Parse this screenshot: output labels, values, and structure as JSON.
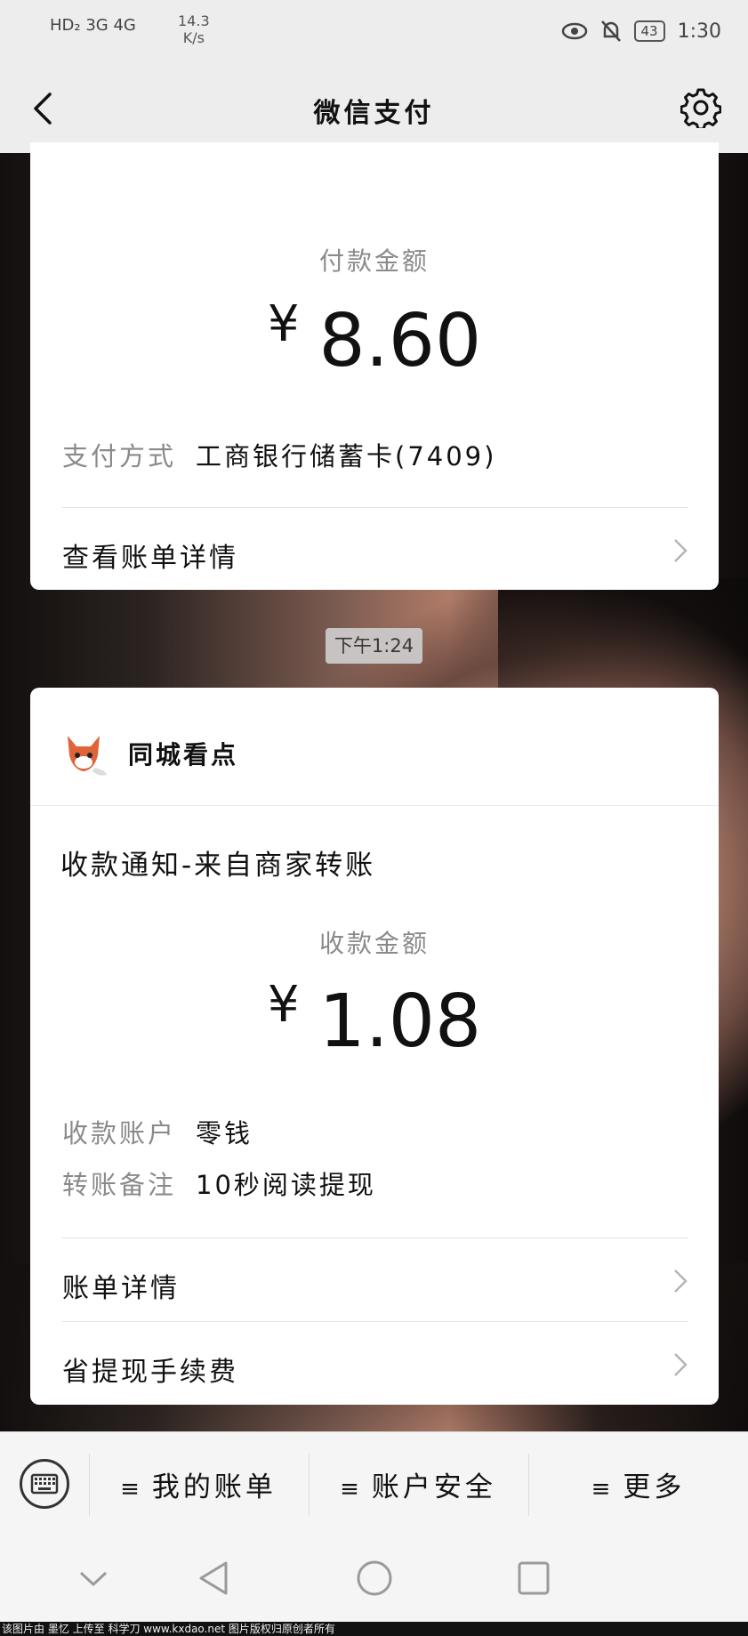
{
  "status_bar": {
    "network": "HD₂ 3G 4G",
    "speed_value": "14.3",
    "speed_unit": "K/s",
    "battery": "43",
    "time": "1:30"
  },
  "nav": {
    "title": "微信支付"
  },
  "payment_card": {
    "amount_label": "付款金额",
    "currency": "¥",
    "amount": "8.60",
    "method_key": "支付方式",
    "method_value": "工商银行储蓄卡(7409)",
    "details_link": "查看账单详情"
  },
  "timestamp": "下午1:24",
  "receipt_card": {
    "source_name": "同城看点",
    "notice_title": "收款通知-来自商家转账",
    "amount_label": "收款金额",
    "currency": "¥",
    "amount": "1.08",
    "account_key": "收款账户",
    "account_value": "零钱",
    "remark_key": "转账备注",
    "remark_value": "10秒阅读提现",
    "bill_details_link": "账单详情",
    "fee_link": "省提现手续费"
  },
  "bottom_menu": {
    "items": [
      {
        "label": "我的账单"
      },
      {
        "label": "账户安全"
      },
      {
        "label": "更多"
      }
    ]
  },
  "watermark": "该图片由 墨忆 上传至 科学刀 www.kxdao.net 图片版权归原创者所有",
  "colors": {
    "bar_bg": "#ededed",
    "card_bg": "#ffffff",
    "muted_text": "#8a8a8a"
  }
}
